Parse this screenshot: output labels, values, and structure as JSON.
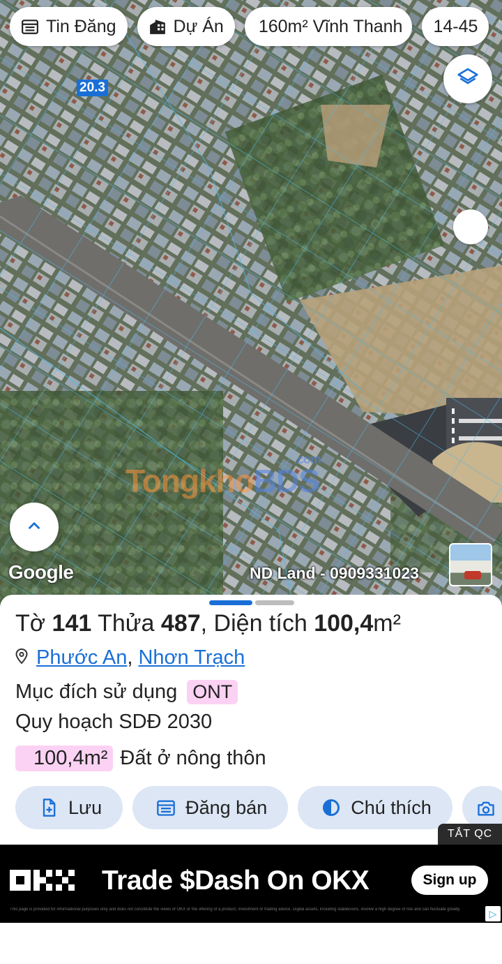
{
  "chips": [
    {
      "label": "Tin Đăng",
      "icon": "calendar-list-icon"
    },
    {
      "label": "Dự Án",
      "icon": "building-icon"
    },
    {
      "label": "160m² Vĩnh Thanh",
      "icon": ""
    },
    {
      "label": "14-45",
      "icon": ""
    }
  ],
  "map": {
    "scale_label": "20.3",
    "google": "Google",
    "contact": "ND Land - 0909331023",
    "watermark": {
      "brand_a": "Tongkho",
      "brand_b": "BDS",
      "suffix": ".com"
    }
  },
  "parcel": {
    "sheet_label": "Tờ",
    "sheet_no": "141",
    "plot_label": "Thửa",
    "plot_no": "487",
    "area_label": ", Diện tích",
    "area": "100,4",
    "area_unit": "m²",
    "ward": "Phước An",
    "district": "Nhơn Trạch",
    "purpose_label": "Mục đích sử dụng",
    "purpose_code": "ONT",
    "plan_label": "Quy hoạch SDĐ 2030",
    "plan_area": "100,4m²",
    "plan_use": "Đất ở nông thôn"
  },
  "actions": [
    {
      "label": "Lưu",
      "icon": "file-plus-icon"
    },
    {
      "label": "Đăng bán",
      "icon": "calendar-icon"
    },
    {
      "label": "Chú thích",
      "icon": "contrast-icon"
    },
    {
      "label": "",
      "icon": "camera-icon"
    }
  ],
  "ad_close": "TẮT QC",
  "ad": {
    "brand": "OKX",
    "headline": "Trade $Dash On OKX",
    "cta": "Sign up",
    "fine_print": "This page is provided for informational purposes only and does not constitute the views of OKX or the offering of a product, investment or trading advice. Digital assets, including stablecoins, involve a high degree of risk and can fluctuate greatly."
  },
  "colors": {
    "accent": "#1a6fd6",
    "badge": "#fbd2f3",
    "button_bg": "#dce6f5",
    "ad_bg": "#000000"
  }
}
